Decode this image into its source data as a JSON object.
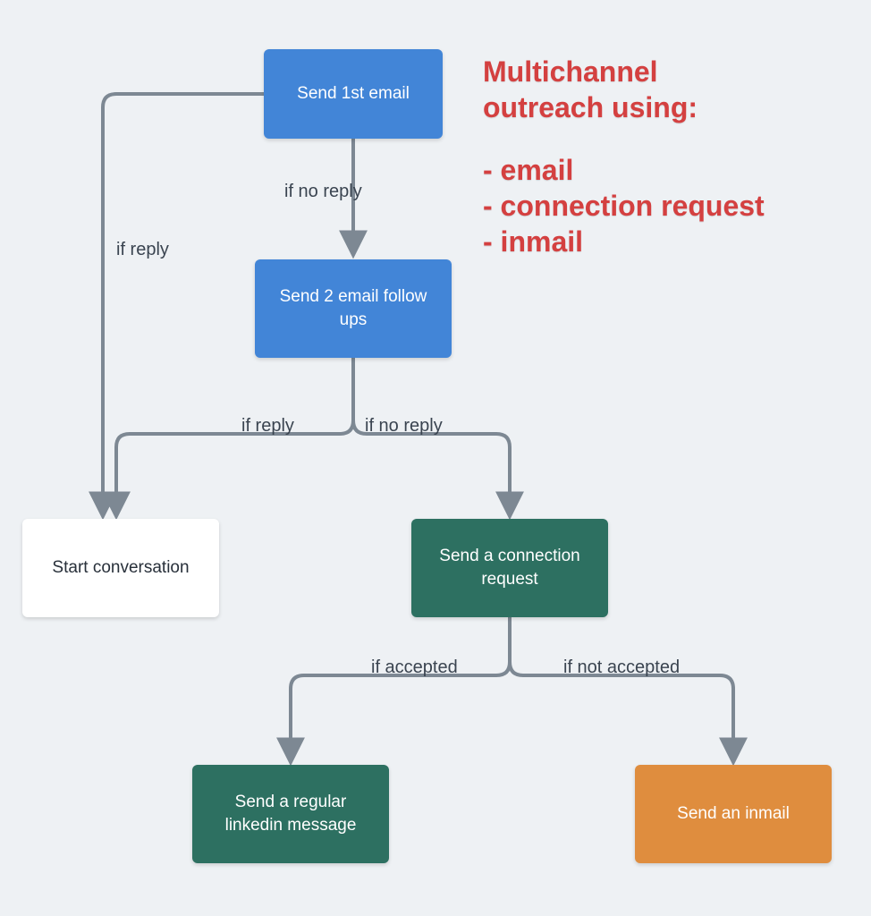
{
  "title": {
    "heading_l1": "Multichannel",
    "heading_l2": "outreach using:",
    "bullets": [
      "- email",
      "- connection request",
      "- inmail"
    ]
  },
  "nodes": {
    "send_first_email": "Send 1st email",
    "send_followups": "Send 2 email follow ups",
    "start_conversation": "Start conversation",
    "send_connection": "Send a connection request",
    "send_linkedin_msg": "Send a regular linkedin message",
    "send_inmail": "Send an inmail"
  },
  "edges": {
    "no_reply_1": "if no reply",
    "reply_left": "if reply",
    "reply_2": "if reply",
    "no_reply_2": "if no reply",
    "accepted": "if accepted",
    "not_accepted": "if not accepted"
  },
  "colors": {
    "blue": "#4285d7",
    "green": "#2d7061",
    "orange": "#df8d3e",
    "red": "#d44040",
    "connector": "#7d8893"
  }
}
